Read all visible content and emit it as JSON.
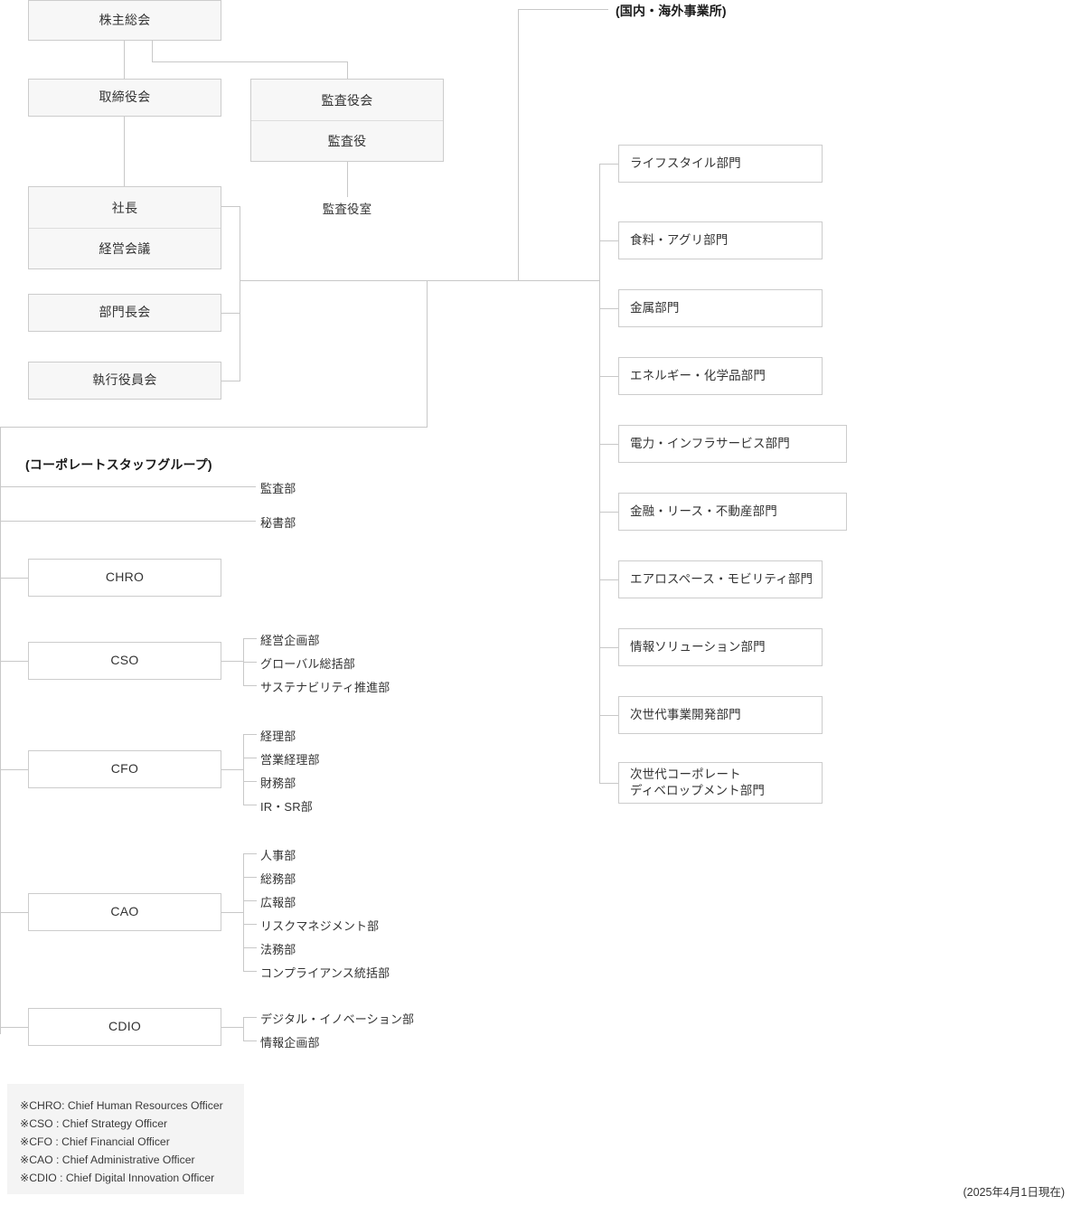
{
  "governance": {
    "shareholders_meeting": "株主総会",
    "board_of_directors": "取締役会",
    "audit_board": "監査役会",
    "auditor": "監査役",
    "audit_office": "監査役室",
    "president": "社長",
    "management_meeting": "経営会議",
    "division_heads_meeting": "部門長会",
    "executive_officers_meeting": "執行役員会"
  },
  "offices_header": "(国内・海外事業所)",
  "corporate_staff": {
    "header": "(コーポレートスタッフグループ)",
    "direct_departments": [
      "監査部",
      "秘書部"
    ],
    "officers": [
      {
        "title": "CHRO",
        "departments": []
      },
      {
        "title": "CSO",
        "departments": [
          "経営企画部",
          "グローバル総括部",
          "サステナビリティ推進部"
        ]
      },
      {
        "title": "CFO",
        "departments": [
          "経理部",
          "営業経理部",
          "財務部",
          "IR・SR部"
        ]
      },
      {
        "title": "CAO",
        "departments": [
          "人事部",
          "総務部",
          "広報部",
          "リスクマネジメント部",
          "法務部",
          "コンプライアンス統括部"
        ]
      },
      {
        "title": "CDIO",
        "departments": [
          "デジタル・イノベーション部",
          "情報企画部"
        ]
      }
    ]
  },
  "business_divisions": [
    "ライフスタイル部門",
    "食料・アグリ部門",
    "金属部門",
    "エネルギー・化学品部門",
    "電力・インフラサービス部門",
    "金融・リース・不動産部門",
    "エアロスペース・モビリティ部門",
    "情報ソリューション部門",
    "次世代事業開発部門"
  ],
  "business_division_multiline": {
    "line1": "次世代コーポレート",
    "line2": "ディベロップメント部門"
  },
  "legend": [
    "※CHRO: Chief Human Resources Officer",
    "※CSO  : Chief Strategy Officer",
    "※CFO  : Chief Financial Officer",
    "※CAO  : Chief Administrative Officer",
    "※CDIO : Chief Digital Innovation Officer"
  ],
  "as_of": "(2025年4月1日現在)",
  "colors": {
    "line": "#c8c8c8",
    "box_border": "#cccccc",
    "box_fill_gray": "#f7f7f7",
    "legend_bg": "#f4f4f4",
    "text": "#333333"
  }
}
